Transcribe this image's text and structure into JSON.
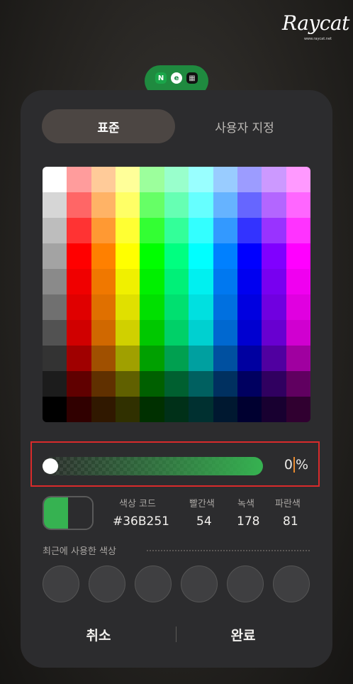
{
  "watermark": {
    "brand": "Raycat",
    "url": "www.raycat.net"
  },
  "peek_icons": [
    "N",
    "e",
    "▦"
  ],
  "tabs": {
    "standard": "표준",
    "custom": "사용자 지정"
  },
  "palette": {
    "rows": [
      [
        "#FFFFFF",
        "#FF9C9C",
        "#FFCB99",
        "#FFFF99",
        "#9CFF9C",
        "#99FFCC",
        "#99FFFF",
        "#99CCFF",
        "#9C9CFF",
        "#CC99FF",
        "#FF99FF"
      ],
      [
        "#D6D6D6",
        "#FF6666",
        "#FFB366",
        "#FFFF66",
        "#66FF66",
        "#66FFB3",
        "#66FFFF",
        "#66B3FF",
        "#6666FF",
        "#B366FF",
        "#FF66FF"
      ],
      [
        "#BDBDBD",
        "#FF3333",
        "#FF9933",
        "#FFFF33",
        "#33FF33",
        "#33FF99",
        "#33FFFF",
        "#3399FF",
        "#3333FF",
        "#9933FF",
        "#FF33FF"
      ],
      [
        "#A3A3A3",
        "#FF0000",
        "#FF8000",
        "#FFFF00",
        "#00FF00",
        "#00FF80",
        "#00FFFF",
        "#0080FF",
        "#0000FF",
        "#8000FF",
        "#FF00FF"
      ],
      [
        "#8A8A8A",
        "#F00000",
        "#F07800",
        "#F0F000",
        "#00F000",
        "#00F078",
        "#00F0F0",
        "#0078F0",
        "#0000F0",
        "#7800F0",
        "#F000F0"
      ],
      [
        "#707070",
        "#E00000",
        "#E07000",
        "#E0E000",
        "#00E000",
        "#00E070",
        "#00E0E0",
        "#0070E0",
        "#0000E0",
        "#7000E0",
        "#E000E0"
      ],
      [
        "#525252",
        "#D00000",
        "#D06800",
        "#D0D000",
        "#00C800",
        "#00D068",
        "#00D0D0",
        "#0068D0",
        "#0000D0",
        "#6800D0",
        "#D000D0"
      ],
      [
        "#333333",
        "#A00000",
        "#A05000",
        "#A0A000",
        "#00A000",
        "#00A050",
        "#00A0A0",
        "#0050A0",
        "#0000A0",
        "#5000A0",
        "#A000A0"
      ],
      [
        "#1C1C1C",
        "#600000",
        "#603000",
        "#606000",
        "#006000",
        "#006030",
        "#006060",
        "#003060",
        "#000060",
        "#300060",
        "#600060"
      ],
      [
        "#000000",
        "#300000",
        "#301800",
        "#303000",
        "#003000",
        "#003018",
        "#003030",
        "#001830",
        "#000030",
        "#180030",
        "#300030"
      ]
    ]
  },
  "opacity": {
    "value_text": "0",
    "unit": "%",
    "level_percent": 0
  },
  "color": {
    "hex_label": "색상 코드",
    "hex": "#36B251",
    "red_label": "빨간색",
    "red": "54",
    "green_label": "녹색",
    "green": "178",
    "blue_label": "파란색",
    "blue": "81",
    "accent": "#36B251"
  },
  "recent": {
    "title": "최근에 사용한 색상",
    "count_slots": 6
  },
  "actions": {
    "cancel": "취소",
    "done": "완료"
  }
}
